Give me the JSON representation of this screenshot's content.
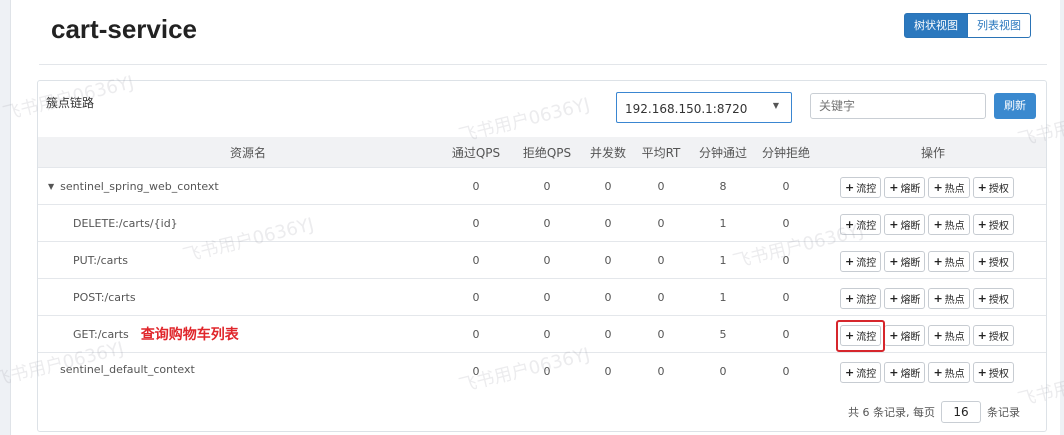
{
  "header": {
    "title": "cart-service",
    "view_tree": "树状视图",
    "view_list": "列表视图"
  },
  "panel": {
    "title": "簇点链路",
    "machine": "192.168.150.1:8720",
    "search_placeholder": "关键字",
    "refresh": "刷新"
  },
  "table": {
    "columns": [
      "资源名",
      "通过QPS",
      "拒绝QPS",
      "并发数",
      "平均RT",
      "分钟通过",
      "分钟拒绝",
      "操作"
    ],
    "rows": [
      {
        "name": "sentinel_spring_web_context",
        "pass_qps": "0",
        "block_qps": "0",
        "threads": "0",
        "avg_rt": "0",
        "min_pass": "8",
        "min_block": "0"
      },
      {
        "name": "DELETE:/carts/{id}",
        "pass_qps": "0",
        "block_qps": "0",
        "threads": "0",
        "avg_rt": "0",
        "min_pass": "1",
        "min_block": "0"
      },
      {
        "name": "PUT:/carts",
        "pass_qps": "0",
        "block_qps": "0",
        "threads": "0",
        "avg_rt": "0",
        "min_pass": "1",
        "min_block": "0"
      },
      {
        "name": "POST:/carts",
        "pass_qps": "0",
        "block_qps": "0",
        "threads": "0",
        "avg_rt": "0",
        "min_pass": "1",
        "min_block": "0"
      },
      {
        "name": "GET:/carts",
        "note": "查询购物车列表",
        "pass_qps": "0",
        "block_qps": "0",
        "threads": "0",
        "avg_rt": "0",
        "min_pass": "5",
        "min_block": "0"
      },
      {
        "name": "sentinel_default_context",
        "pass_qps": "0",
        "block_qps": "0",
        "threads": "0",
        "avg_rt": "0",
        "min_pass": "0",
        "min_block": "0"
      }
    ],
    "ops": {
      "flow": "流控",
      "degrade": "熔断",
      "hot": "热点",
      "auth": "授权",
      "plus": "+"
    }
  },
  "footer": {
    "prefix": "共 6 条记录, 每页",
    "page_size": "16",
    "suffix": "条记录"
  },
  "watermark": "飞书用户0636YJ",
  "colors": {
    "primary": "#2b78be",
    "highlight": "#d6262c",
    "note": "#e0262b"
  }
}
